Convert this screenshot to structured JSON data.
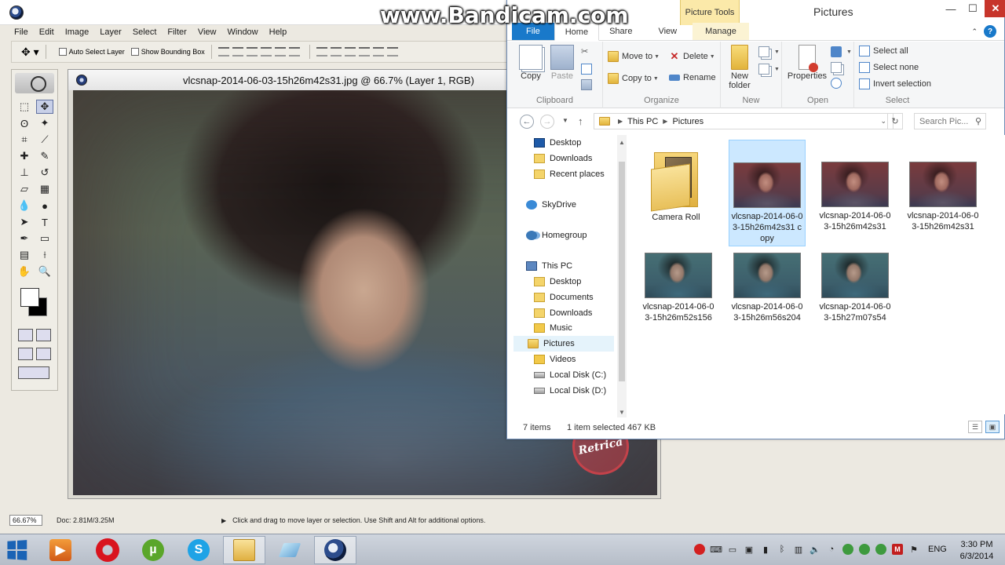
{
  "watermark": "www.Bandicam.com",
  "photoshop": {
    "menu": [
      "File",
      "Edit",
      "Image",
      "Layer",
      "Select",
      "Filter",
      "View",
      "Window",
      "Help"
    ],
    "options": {
      "auto_select_layer": "Auto Select Layer",
      "show_bounding_box": "Show Bounding Box"
    },
    "document_title": "vlcsnap-2014-06-03-15h26m42s31.jpg @ 66.7% (Layer 1, RGB)",
    "watermark_logo": "Retrica",
    "status": {
      "zoom": "66.67%",
      "doc_size": "Doc: 2.81M/3.25M",
      "hint": "Click and drag to move layer or selection. Use Shift and Alt for additional options."
    }
  },
  "explorer": {
    "title": "Pictures",
    "contextual_tab": "Picture Tools",
    "tabs": [
      "File",
      "Home",
      "Share",
      "View",
      "Manage"
    ],
    "ribbon": {
      "clipboard": {
        "label": "Clipboard",
        "copy": "Copy",
        "paste": "Paste"
      },
      "organize": {
        "label": "Organize",
        "move_to": "Move to",
        "copy_to": "Copy to",
        "delete": "Delete",
        "rename": "Rename"
      },
      "new": {
        "label": "New",
        "new_folder": "New folder"
      },
      "open": {
        "label": "Open",
        "properties": "Properties"
      },
      "select": {
        "label": "Select",
        "select_all": "Select all",
        "select_none": "Select none",
        "invert": "Invert selection"
      }
    },
    "address": {
      "root": "This PC",
      "current": "Pictures"
    },
    "search_placeholder": "Search Pic...",
    "nav": [
      {
        "label": "Desktop",
        "icon": "desktop-icon"
      },
      {
        "label": "Downloads",
        "icon": "downloads-icon"
      },
      {
        "label": "Recent places",
        "icon": "recent-places-icon"
      },
      {
        "label": "SkyDrive",
        "icon": "skydrive-icon"
      },
      {
        "label": "Homegroup",
        "icon": "homegroup-icon"
      },
      {
        "label": "This PC",
        "icon": "computer-icon"
      },
      {
        "label": "Desktop",
        "icon": "desktop-icon"
      },
      {
        "label": "Documents",
        "icon": "documents-icon"
      },
      {
        "label": "Downloads",
        "icon": "downloads-icon"
      },
      {
        "label": "Music",
        "icon": "music-icon"
      },
      {
        "label": "Pictures",
        "icon": "pictures-icon"
      },
      {
        "label": "Videos",
        "icon": "videos-icon"
      },
      {
        "label": "Local Disk (C:)",
        "icon": "disk-icon"
      },
      {
        "label": "Local Disk (D:)",
        "icon": "disk-icon"
      }
    ],
    "files": [
      {
        "name": "Camera Roll",
        "type": "folder"
      },
      {
        "name": "vlcsnap-2014-06-03-15h26m42s31 copy",
        "type": "image",
        "selected": true
      },
      {
        "name": "vlcsnap-2014-06-03-15h26m42s31",
        "type": "image"
      },
      {
        "name": "vlcsnap-2014-06-03-15h26m42s31",
        "type": "image"
      },
      {
        "name": "vlcsnap-2014-06-03-15h26m52s156",
        "type": "image"
      },
      {
        "name": "vlcsnap-2014-06-03-15h26m56s204",
        "type": "image"
      },
      {
        "name": "vlcsnap-2014-06-03-15h27m07s54",
        "type": "image"
      }
    ],
    "status": {
      "count": "7 items",
      "selected": "1 item selected  467 KB"
    }
  },
  "taskbar": {
    "language": "ENG",
    "time": "3:30 PM",
    "date": "6/3/2014"
  },
  "colors": {
    "explorer_file_tab": "#1979ca",
    "picture_tools": "#fbe9a9",
    "selection": "#cce8ff",
    "close_button": "#c7352b"
  }
}
